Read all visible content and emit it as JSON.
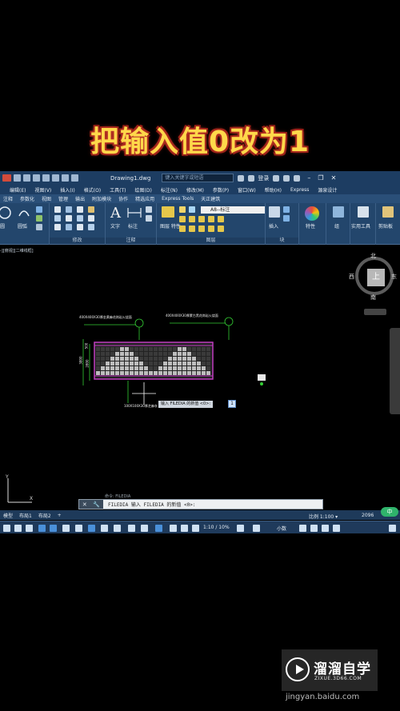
{
  "caption": "把输入值0改为1",
  "colors": {
    "accent": "#ffd84a",
    "titlebar": "#1d3d62",
    "ribbon": "#23466c",
    "hatch_border": "#c03cc0",
    "dim_green": "#33cc33"
  },
  "titlebar": {
    "filename": "Drawing1.dwg",
    "search_placeholder": "键入关键字或短语",
    "login": "登录"
  },
  "menu": [
    "编辑(E)",
    "视图(V)",
    "插入(I)",
    "格式(O)",
    "工具(T)",
    "绘图(D)",
    "标注(N)",
    "修改(M)",
    "参数(P)",
    "窗口(W)",
    "帮助(H)",
    "Express",
    "源泉设计"
  ],
  "tabs": [
    "注释",
    "参数化",
    "视图",
    "管理",
    "输出",
    "附加模块",
    "协作",
    "精选应用",
    "Express Tools",
    "天正建筑"
  ],
  "ribbon": {
    "draw_partial": "圆",
    "arc_label": "圆弧",
    "modify_label": "修改",
    "text_label": "文字",
    "dim_label": "标注",
    "annotation_label": "注释",
    "layer_label": "图层",
    "layer_props_label": "图层\n特性",
    "layer_dropdown": "A8--标注",
    "insert_label": "插入",
    "block_label": "块",
    "props_label": "特性",
    "group_label": "组",
    "utilities_label": "实用工具",
    "clipboard_label": "剪贴板"
  },
  "doc_tab": "-][俯视][二维线框]",
  "compass": {
    "north": "北",
    "south": "南",
    "east": "东",
    "west": "西",
    "center": "上"
  },
  "drawing": {
    "dim_top_left": "400X400X30厚金黄麻花岗岩火烧面",
    "dim_top_right": "400X400X30厚蒙古黑花岗岩火烧面",
    "dim_bottom": "100X100X30厚芝麻灰",
    "dim_v1": "3800",
    "dim_v2": "2800",
    "dim_v3": "500"
  },
  "tooltip": {
    "text": "输入 FILEDIA 的新值 <0>:",
    "value": "1"
  },
  "cmd_history": "命令: FILEDIA",
  "cmdline": {
    "text": "FILEDIA 输入 FILEDIA 的新值 <0>:"
  },
  "layout_tabs": [
    "模型",
    "布局1",
    "布局2",
    "+"
  ],
  "scale_text": "比例 1:100 ▾",
  "coord_text": "2096",
  "badge": "中",
  "status": {
    "zoom": "1:10 / 10%",
    "style": "小数"
  },
  "watermark": {
    "name": "溜溜自学",
    "url": "ZIXUE.3D66.COM",
    "footer": "jingyan.baidu.com"
  }
}
